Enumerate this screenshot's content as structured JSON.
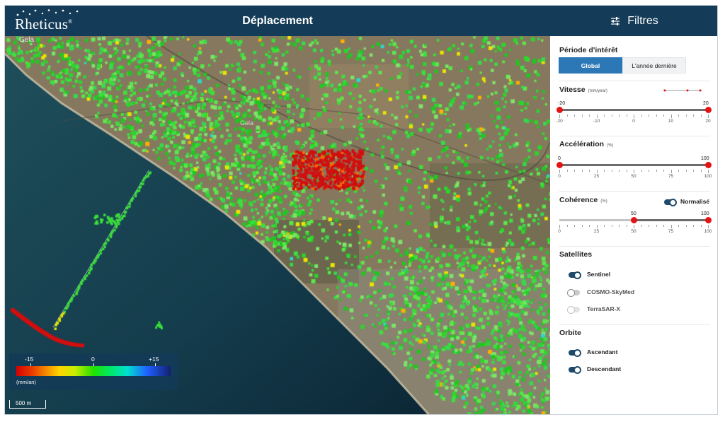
{
  "header": {
    "logo_text": "Rheticus",
    "logo_reg": "®",
    "title": "Déplacement",
    "filters_label": "Filtres"
  },
  "map": {
    "place_label": "Gela",
    "town_label": "Gela",
    "legend": {
      "min_label": "-15",
      "mid_label": "0",
      "max_label": "+15",
      "unit": "(mm/an)"
    },
    "scale_label": "500 m"
  },
  "filters": {
    "period": {
      "title": "Période d'intérêt",
      "options": [
        "Global",
        "L'année dernière"
      ],
      "selected": "Global"
    },
    "velocity": {
      "title": "Vitesse",
      "unit": "(mm/year)",
      "min": -20,
      "max": 20,
      "low": -20,
      "high": 20,
      "low_label": "-20",
      "high_label": "20",
      "ticks": [
        "-20",
        "-10",
        "0",
        "10",
        "20"
      ]
    },
    "acceleration": {
      "title": "Accélération",
      "unit": "(%)",
      "min": 0,
      "max": 100,
      "low": 0,
      "high": 100,
      "low_label": "0",
      "high_label": "100",
      "ticks": [
        "0",
        "25",
        "50",
        "75",
        "100"
      ]
    },
    "coherence": {
      "title": "Cohérence",
      "unit": "(%)",
      "min": 0,
      "max": 100,
      "low": 50,
      "high": 100,
      "low_label": "50",
      "high_label": "100",
      "ticks": [
        "0",
        "25",
        "50",
        "75",
        "100"
      ],
      "normalized_label": "Normalisé",
      "normalized": true
    },
    "satellites": {
      "title": "Satellites",
      "items": [
        {
          "label": "Sentinel",
          "on": true
        },
        {
          "label": "COSMO-SkyMed",
          "on": false
        },
        {
          "label": "TerraSAR-X",
          "on": false
        }
      ]
    },
    "orbit": {
      "title": "Orbite",
      "items": [
        {
          "label": "Ascendant",
          "on": true
        },
        {
          "label": "Descendant",
          "on": true
        }
      ]
    }
  },
  "colors": {
    "header_bg": "#143b57",
    "accent": "#2c78b7",
    "thumb": "#e41414",
    "toggle_on": "#1f4a6b"
  }
}
